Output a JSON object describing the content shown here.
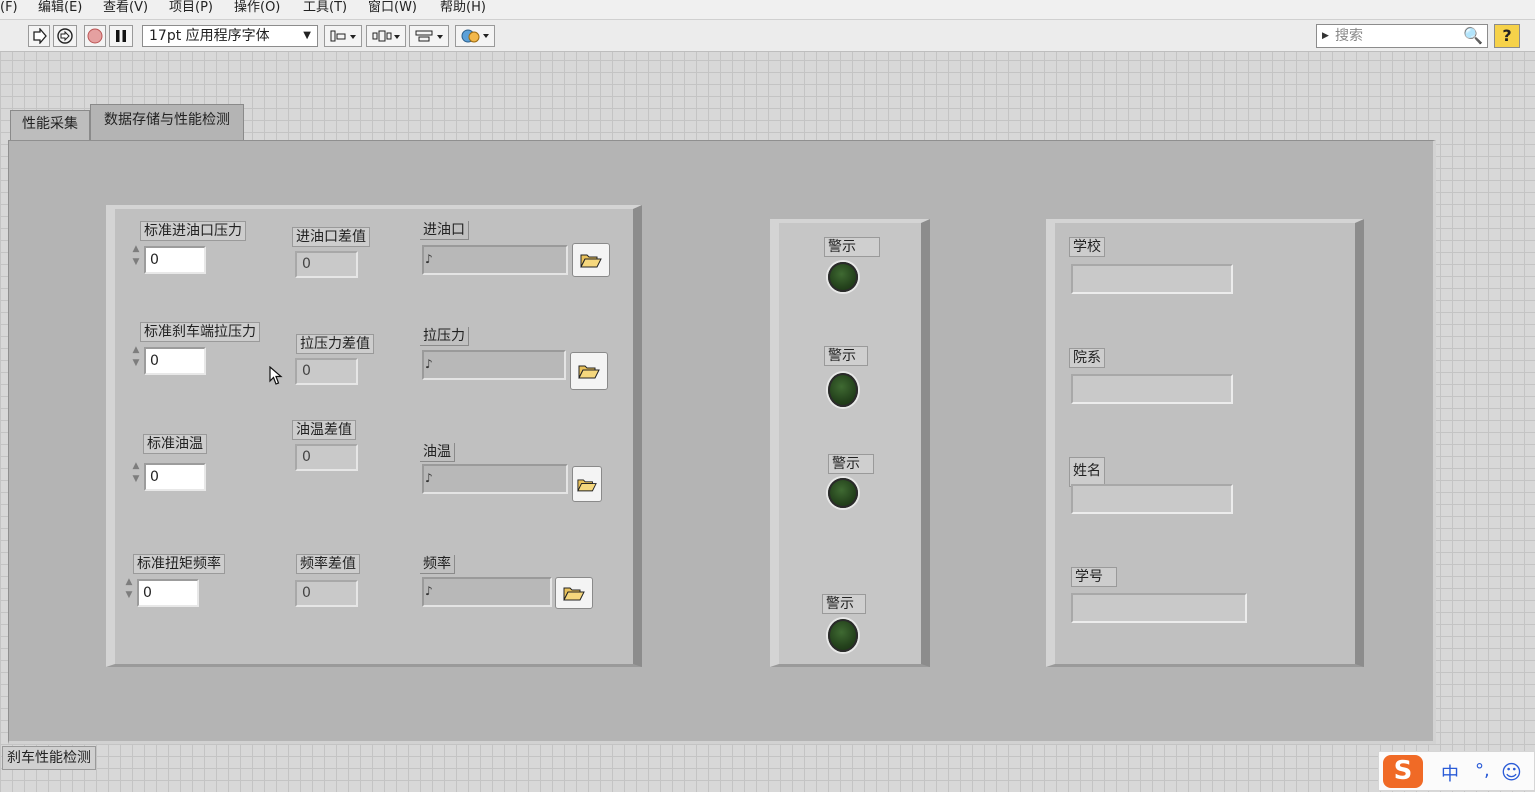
{
  "menubar": {
    "items": [
      "(F)",
      "编辑(E)",
      "查看(V)",
      "项目(P)",
      "操作(O)",
      "工具(T)",
      "窗口(W)",
      "帮助(H)"
    ]
  },
  "toolbar": {
    "run_icon": "run-arrow-icon",
    "run_continuous_icon": "run-continuously-icon",
    "abort_icon": "abort-icon",
    "pause_icon": "pause-icon",
    "font_label": "17pt 应用程序字体",
    "align_icon": "align-objects-icon",
    "distribute_icon": "distribute-objects-icon",
    "resize_icon": "resize-objects-icon",
    "reorder_icon": "reorder-icon",
    "search_placeholder": "搜索",
    "help_label": "?"
  },
  "tabs": [
    {
      "label": "性能采集",
      "selected": false
    },
    {
      "label": "数据存储与性能检测",
      "selected": true
    }
  ],
  "left_cluster": {
    "std_controls": [
      {
        "label": "标准进油口压力",
        "value": "0"
      },
      {
        "label": "标准刹车端拉压力",
        "value": "0"
      },
      {
        "label": "标准油温",
        "value": "0"
      },
      {
        "label": "标准扭矩频率",
        "value": "0"
      }
    ],
    "diff_indicators": [
      {
        "label": "进油口差值",
        "value": "0"
      },
      {
        "label": "拉压力差值",
        "value": "0"
      },
      {
        "label": "油温差值",
        "value": "0"
      },
      {
        "label": "频率差值",
        "value": "0"
      }
    ],
    "paths": [
      {
        "label": "进油口",
        "value": ""
      },
      {
        "label": "拉压力",
        "value": ""
      },
      {
        "label": "油温",
        "value": ""
      },
      {
        "label": "频率",
        "value": ""
      }
    ]
  },
  "warning_cluster": {
    "leds": [
      {
        "label": "警示"
      },
      {
        "label": "警示"
      },
      {
        "label": "警示"
      },
      {
        "label": "警示"
      }
    ]
  },
  "info_cluster": {
    "fields": [
      {
        "label": "学校",
        "value": ""
      },
      {
        "label": "院系",
        "value": ""
      },
      {
        "label": "姓名",
        "value": ""
      },
      {
        "label": "学号",
        "value": ""
      }
    ]
  },
  "window_label": "刹车性能检测",
  "ime": {
    "logo": "S",
    "mode": "中",
    "punct": "°,",
    "emoji_icon": "smiley-icon"
  },
  "colors": {
    "panel_bg": "#b4b4b4",
    "cluster_bg": "#c0c0c0",
    "led_off": "#24421c",
    "help_yellow": "#f6d24a",
    "ime_orange": "#f06a26"
  }
}
